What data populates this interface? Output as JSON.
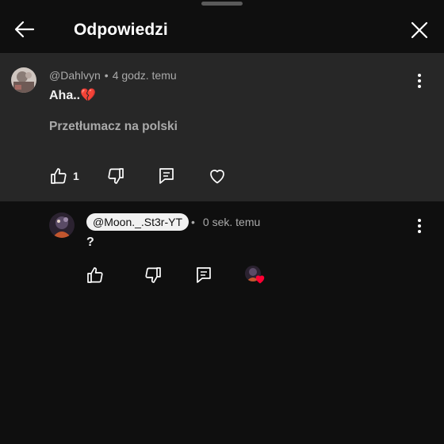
{
  "header": {
    "title": "Odpowiedzi",
    "back_icon": "arrow-left-icon",
    "close_icon": "close-icon"
  },
  "parent_comment": {
    "author": "@Dahlvyn",
    "separator": "•",
    "time": "4 godz. temu",
    "text": "Aha..💔",
    "translate_label": "Przetłumacz na polski",
    "like_count": "1",
    "icons": [
      "thumbs-up-icon",
      "thumbs-down-icon",
      "reply-icon",
      "heart-outline-icon",
      "more-vertical-icon"
    ]
  },
  "reply": {
    "author": "@Moon._.St3r-YT",
    "separator": "•",
    "time": "0 sek. temu",
    "text": "?",
    "icons": [
      "thumbs-up-icon",
      "thumbs-down-icon",
      "reply-icon",
      "creator-heart-icon",
      "more-vertical-icon"
    ]
  },
  "colors": {
    "background": "#0f0f0f",
    "highlight": "#272727",
    "secondary_text": "#aaaaaa",
    "heart": "#ff0033"
  }
}
